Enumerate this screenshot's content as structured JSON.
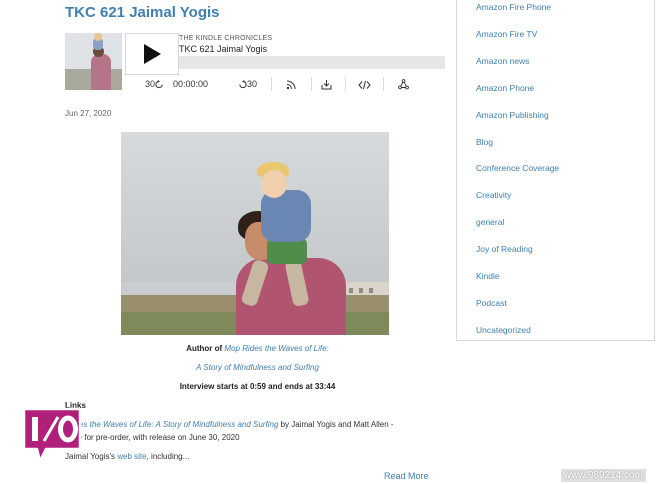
{
  "post": {
    "title": "TKC 621 Jaimal Yogis",
    "date": "Jun 27, 2020"
  },
  "player": {
    "show_name": "THE KINDLE CHRONICLES",
    "episode_name": "TKC 621 Jaimal Yogis",
    "rewind_label": "30",
    "time": "00:00:00",
    "forward_label": "30",
    "progress": 0,
    "icons": [
      "play-icon",
      "rewind-30-icon",
      "forward-30-icon",
      "rss-icon",
      "download-icon",
      "embed-icon",
      "share-icon"
    ]
  },
  "caption": {
    "line1_prefix": "Author of ",
    "line1_link": "Mop Rides the Waves of Life:",
    "line2_link": "A Story of Mindfulness and Surfing",
    "line3": "Interview starts at 0:59 and ends at 33:44"
  },
  "links": {
    "heading": "Links",
    "item1_link": "Rides the Waves of Life: A Story of Mindfulness and Surfing",
    "item1_rest": " by Jaimal Yogis and Matt Allen -",
    "item1_line2": "able for pre-order, with release on June 30, 2020",
    "item2_prefix": "Jaimal Yogis's ",
    "item2_link": "web site",
    "item2_suffix": ", including..."
  },
  "read_more": "Read More",
  "sidebar": {
    "categories": [
      "Amazon Fire Phone",
      "Amazon Fire TV",
      "Amazon news",
      "Amazon Phone",
      "Amazon Publishing",
      "Blog",
      "Conference Coverage",
      "Creativity",
      "general",
      "Joy of Reading",
      "Kindle",
      "Podcast",
      "Uncategorized"
    ]
  },
  "watermark": "www.989214.com",
  "colors": {
    "link": "#3f80b0",
    "logo": "#b0207a"
  }
}
